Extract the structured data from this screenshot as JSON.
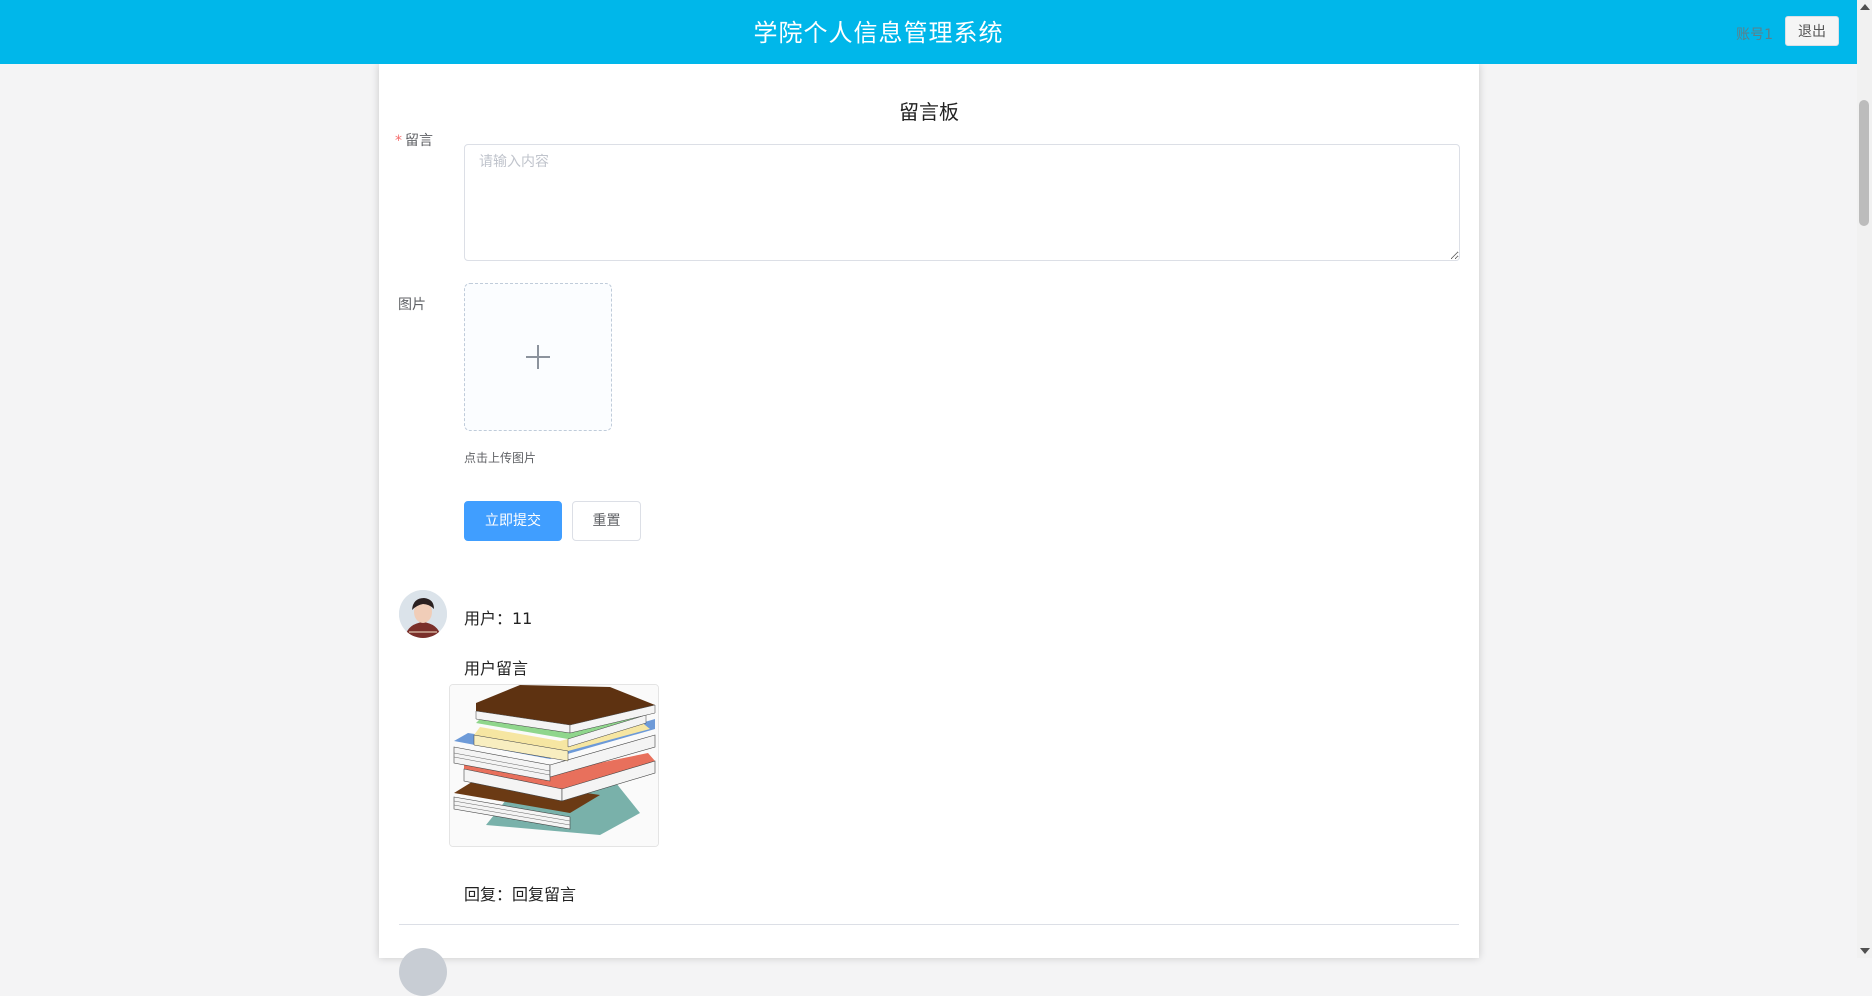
{
  "header": {
    "title": "学院个人信息管理系统",
    "account": "账号1",
    "logout_label": "退出"
  },
  "board": {
    "title": "留言板",
    "message_label": "留言",
    "required_mark": "*",
    "message_placeholder": "请输入内容",
    "image_label": "图片",
    "upload_tip": "点击上传图片",
    "submit_label": "立即提交",
    "reset_label": "重置"
  },
  "messages": [
    {
      "user": "用户：11",
      "content": "用户留言",
      "reply": "回复：回复留言"
    }
  ],
  "colors": {
    "header_bg": "#00b7ea",
    "primary": "#409eff",
    "required": "#f56c6c"
  }
}
